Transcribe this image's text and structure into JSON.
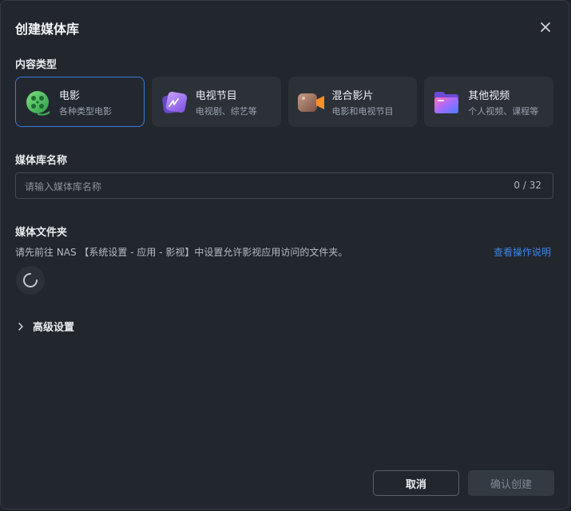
{
  "dialog": {
    "title": "创建媒体库"
  },
  "content_type": {
    "label": "内容类型",
    "options": [
      {
        "name": "电影",
        "desc": "各种类型电影",
        "icon": "movie-reel-icon",
        "selected": true
      },
      {
        "name": "电视节目",
        "desc": "电视剧、综艺等",
        "icon": "tv-icon",
        "selected": false
      },
      {
        "name": "混合影片",
        "desc": "电影和电视节目",
        "icon": "video-camera-icon",
        "selected": false
      },
      {
        "name": "其他视频",
        "desc": "个人视频、课程等",
        "icon": "folder-icon",
        "selected": false
      }
    ]
  },
  "library_name": {
    "label": "媒体库名称",
    "placeholder": "请输入媒体库名称",
    "value": "",
    "counter": "0 / 32"
  },
  "media_folder": {
    "label": "媒体文件夹",
    "hint": "请先前往 NAS 【系统设置 - 应用 - 影视】中设置允许影视应用访问的文件夹。",
    "help_link": "查看操作说明"
  },
  "advanced": {
    "label": "高级设置"
  },
  "footer": {
    "cancel_label": "取消",
    "confirm_label": "确认创建"
  },
  "colors": {
    "accent": "#3b7be0",
    "link": "#3d86e8",
    "background": "#22262d"
  }
}
